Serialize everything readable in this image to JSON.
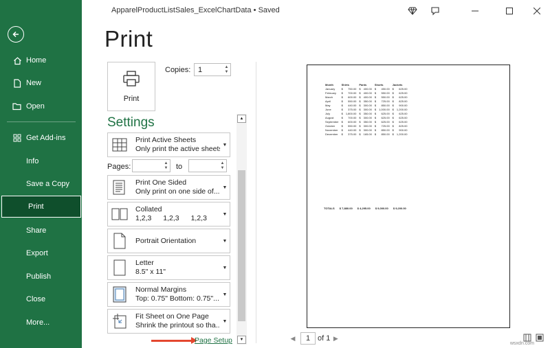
{
  "window": {
    "title": "ApparelProductListSales_ExcelChartData • Saved"
  },
  "nav": {
    "items": [
      "Home",
      "New",
      "Open",
      "Get Add-ins",
      "Info",
      "Save a Copy",
      "Print",
      "Share",
      "Export",
      "Publish",
      "Close",
      "More..."
    ],
    "active": "Print"
  },
  "page_title": "Print",
  "print_button": {
    "label": "Print"
  },
  "copies": {
    "label": "Copies:",
    "value": "1"
  },
  "settings": {
    "title": "Settings",
    "sheets": {
      "main": "Print Active Sheets",
      "sub": "Only print the active sheets"
    },
    "pages": {
      "label": "Pages:",
      "to_label": "to",
      "from_value": "",
      "to_value": ""
    },
    "sides": {
      "main": "Print One Sided",
      "sub": "Only print on one side of..."
    },
    "collation": {
      "main": "Collated",
      "sub": [
        "1,2,3",
        "1,2,3",
        "1,2,3"
      ]
    },
    "orientation": {
      "main": "Portrait Orientation"
    },
    "paper": {
      "main": "Letter",
      "sub": "8.5\" x 11\""
    },
    "margins": {
      "main": "Normal Margins",
      "sub": "Top: 0.75\" Bottom: 0.75\"..."
    },
    "scaling": {
      "main": "Fit Sheet on One Page",
      "sub": "Shrink the printout so tha..."
    },
    "page_setup": "Page Setup"
  },
  "preview": {
    "header": [
      "Month",
      "Shirts",
      "Pants",
      "Shorts",
      "Jackets"
    ],
    "rows": [
      [
        "January",
        "$",
        "750.00",
        "$",
        "400.00",
        "$",
        "450.00",
        "$",
        "625.00"
      ],
      [
        "February",
        "$",
        "700.00",
        "$",
        "400.00",
        "$",
        "550.00",
        "$",
        "625.00"
      ],
      [
        "March",
        "$",
        "600.00",
        "$",
        "400.00",
        "$",
        "550.00",
        "$",
        "625.00"
      ],
      [
        "April",
        "$",
        "550.00",
        "$",
        "350.00",
        "$",
        "725.00",
        "$",
        "825.00"
      ],
      [
        "May",
        "$",
        "440.00",
        "$",
        "300.00",
        "$",
        "850.00",
        "$",
        "900.00"
      ],
      [
        "June",
        "$",
        "375.00",
        "$",
        "300.00",
        "$",
        "1,000.00",
        "$",
        "1,200.00"
      ],
      [
        "July",
        "$",
        "1,800.00",
        "$",
        "350.00",
        "$",
        "625.00",
        "$",
        "625.00"
      ],
      [
        "August",
        "$",
        "700.00",
        "$",
        "300.00",
        "$",
        "625.00",
        "$",
        "625.00"
      ],
      [
        "September",
        "$",
        "600.00",
        "$",
        "350.00",
        "$",
        "625.00",
        "$",
        "625.00"
      ],
      [
        "October",
        "$",
        "550.00",
        "$",
        "300.00",
        "$",
        "725.00",
        "$",
        "825.00"
      ],
      [
        "November",
        "$",
        "440.00",
        "$",
        "300.00",
        "$",
        "850.00",
        "$",
        "900.00"
      ],
      [
        "December",
        "$",
        "375.00",
        "$",
        "165.00",
        "$",
        "850.00",
        "$",
        "1,200.00"
      ]
    ],
    "totals": [
      "TOTALS",
      "$ 7,880.00",
      "$ 4,295.00",
      "$ 9,000.00",
      "$ 9,200.00"
    ]
  },
  "pager": {
    "current": "1",
    "of_label": "of 1"
  },
  "watermark": "wsxdn.com",
  "colors": {
    "accent": "#1f7244",
    "annotation_arrow": "#e4472f"
  }
}
